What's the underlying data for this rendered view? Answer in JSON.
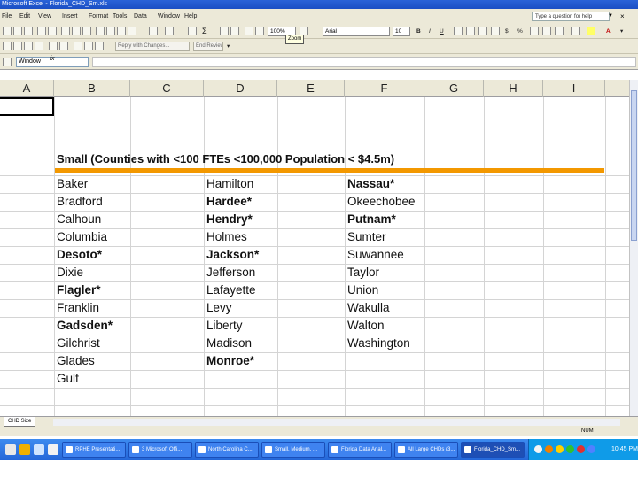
{
  "window": {
    "title": "Microsoft Excel - Florida_CHD_Sm.xls"
  },
  "menu": {
    "items": [
      "File",
      "Edit",
      "View",
      "Insert",
      "Format",
      "Tools",
      "Data",
      "Window",
      "Help"
    ],
    "help_placeholder": "Type a question for help"
  },
  "toolbar": {
    "zoom": "100%",
    "zoom_tooltip": "Zoom",
    "font": "Arial",
    "font_size": "10",
    "sigma": "Σ",
    "reply_label": "Reply with Changes...",
    "end_review_label": "End Review..."
  },
  "formula_bar": {
    "name_box": "Window",
    "fx": "fx",
    "value": ""
  },
  "columns": [
    "A",
    "B",
    "C",
    "D",
    "E",
    "F",
    "G",
    "H",
    "I"
  ],
  "sheet": {
    "title": "Small (Counties with <100 FTEs <100,000 Population < $4.5m)",
    "column_b": [
      {
        "name": "Baker",
        "bold": false
      },
      {
        "name": "Bradford",
        "bold": false
      },
      {
        "name": "Calhoun",
        "bold": false
      },
      {
        "name": "Columbia",
        "bold": false
      },
      {
        "name": "Desoto*",
        "bold": true
      },
      {
        "name": "Dixie",
        "bold": false
      },
      {
        "name": "Flagler*",
        "bold": true
      },
      {
        "name": "Franklin",
        "bold": false
      },
      {
        "name": "Gadsden*",
        "bold": true
      },
      {
        "name": "Gilchrist",
        "bold": false
      },
      {
        "name": "Glades",
        "bold": false
      },
      {
        "name": "Gulf",
        "bold": false
      }
    ],
    "column_d": [
      {
        "name": "Hamilton",
        "bold": false
      },
      {
        "name": "Hardee*",
        "bold": true
      },
      {
        "name": "Hendry*",
        "bold": true
      },
      {
        "name": "Holmes",
        "bold": false
      },
      {
        "name": "Jackson*",
        "bold": true
      },
      {
        "name": "Jefferson",
        "bold": false
      },
      {
        "name": "Lafayette",
        "bold": false
      },
      {
        "name": "Levy",
        "bold": false
      },
      {
        "name": "Liberty",
        "bold": false
      },
      {
        "name": "Madison",
        "bold": false
      },
      {
        "name": "Monroe*",
        "bold": true
      }
    ],
    "column_f": [
      {
        "name": "Nassau*",
        "bold": true
      },
      {
        "name": "Okeechobee",
        "bold": false
      },
      {
        "name": "Putnam*",
        "bold": true
      },
      {
        "name": "Sumter",
        "bold": false
      },
      {
        "name": "Suwannee",
        "bold": false
      },
      {
        "name": "Taylor",
        "bold": false
      },
      {
        "name": "Union",
        "bold": false
      },
      {
        "name": "Wakulla",
        "bold": false
      },
      {
        "name": "Walton",
        "bold": false
      },
      {
        "name": "Washington",
        "bold": false
      }
    ]
  },
  "sheet_tab": "CHD Size",
  "status": {
    "numlock": "NUM"
  },
  "taskbar": {
    "tasks": [
      "RPHE Presentati...",
      "3 Microsoft Offi...",
      "North Carolina C...",
      "Small, Medium, ...",
      "Florida Data Anal...",
      "All Large CHDs (3...",
      "Florida_CHD_Sm..."
    ],
    "active_index": 6,
    "clock": "10:45 PM"
  },
  "colors": {
    "accent_orange": "#f39800",
    "titlebar_blue": "#1b4fc4",
    "taskbar_blue": "#2466d8"
  }
}
